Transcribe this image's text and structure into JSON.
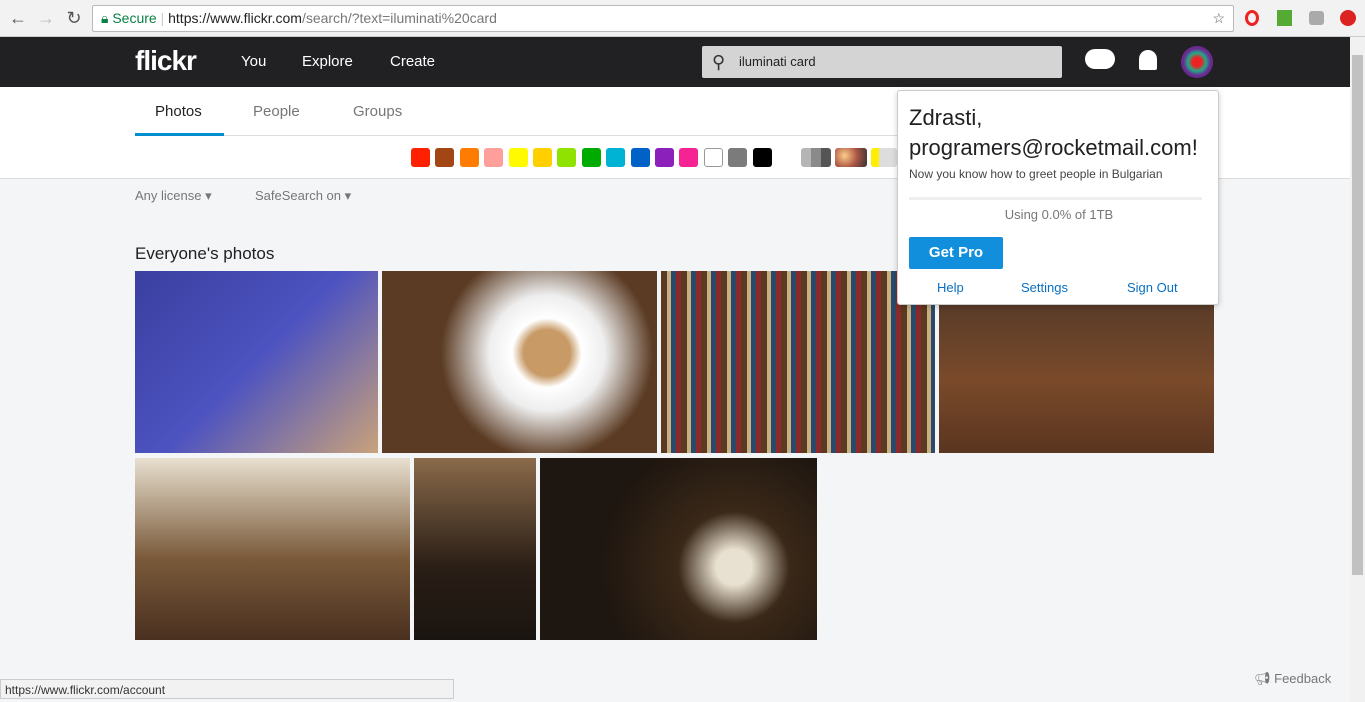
{
  "browser": {
    "secure": "Secure",
    "url_host": "https://www.flickr.com",
    "url_path": "/search/?text=iluminati%20card"
  },
  "header": {
    "logo": "flickr",
    "nav": [
      "You",
      "Explore",
      "Create"
    ],
    "search_value": "iluminati card"
  },
  "tabs": [
    "Photos",
    "People",
    "Groups"
  ],
  "active_tab": "Photos",
  "colors": [
    "#ff2000",
    "#a24615",
    "#ff7c00",
    "#ff9f9c",
    "#fffa00",
    "#ffcf00",
    "#90e200",
    "#00ab00",
    "#00b2d4",
    "#0062c6",
    "#8c20ba",
    "#f52394",
    "#ffffff",
    "#7b7b7b",
    "#000000"
  ],
  "filters": {
    "license": "Any license",
    "safesearch": "SafeSearch on"
  },
  "section_title": "Everyone's photos",
  "popup": {
    "greeting": "Zdrasti,",
    "email": "programers@rocketmail.com!",
    "subtitle": "Now you know how to greet people in Bulgarian",
    "usage": "Using 0.0% of 1TB",
    "usage_fraction": 0.0,
    "get_pro": "Get Pro",
    "help": "Help",
    "settings": "Settings",
    "signout": "Sign Out"
  },
  "status_url": "https://www.flickr.com/account",
  "feedback": "Feedback"
}
